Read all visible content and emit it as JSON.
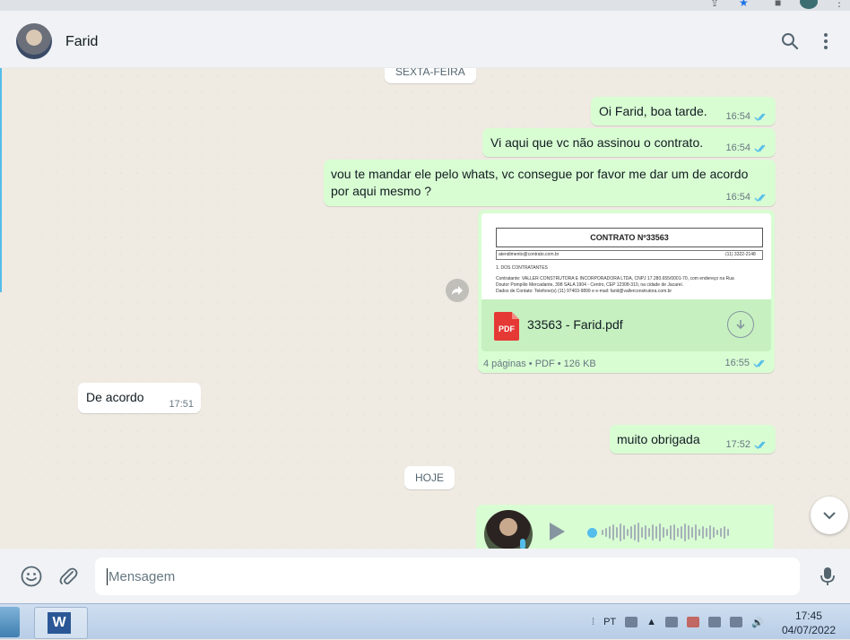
{
  "header": {
    "contact_name": "Farid"
  },
  "dates": {
    "previous": "SEXTA-FEIRA",
    "today": "HOJE"
  },
  "messages": [
    {
      "text": "Oi Farid, boa tarde.",
      "time": "16:54"
    },
    {
      "text": "Vi aqui que vc não assinou o contrato.",
      "time": "16:54"
    },
    {
      "text": "vou te mandar ele pelo whats, vc consegue por favor me dar um de acordo",
      "text2": "por aqui mesmo ?",
      "time": "16:54"
    },
    {
      "text": "De acordo",
      "time": "17:51"
    },
    {
      "text": "muito obrigada",
      "time": "17:52"
    }
  ],
  "document": {
    "preview_title": "CONTRATO Nº33563",
    "preview_email": "atendimento@contrato.com.br",
    "preview_phone": "(11) 3322-2148",
    "preview_section": "1. DOS CONTRATANTES",
    "preview_line1": "Contratante: VALLER CONSTRUTORA E INCORPORADORA LTDA, CNPJ 17.280.655/0001-70, com endereço na Rua",
    "preview_line2": "Doutor Pompilio Mercadante, 398 SALA 1904 - Centro, CEP 12308-310, na cidade de Jacareí.",
    "preview_line3": "Dados de Contato: Telefone(s) (11) 97403-9899 e e-mail: farid@vallerconstrutora.com.br",
    "file_icon_label": "PDF",
    "file_name": "33563 - Farid.pdf",
    "pages": "4 páginas",
    "type": "PDF",
    "size": "126 KB",
    "time": "16:55"
  },
  "composer": {
    "placeholder": "Mensagem"
  },
  "taskbar": {
    "lang": "PT",
    "time": "17:45",
    "date": "04/07/2022"
  },
  "colors": {
    "outgoing": "#d9fdd3",
    "incoming": "#ffffff",
    "ticks": "#53bdeb"
  }
}
